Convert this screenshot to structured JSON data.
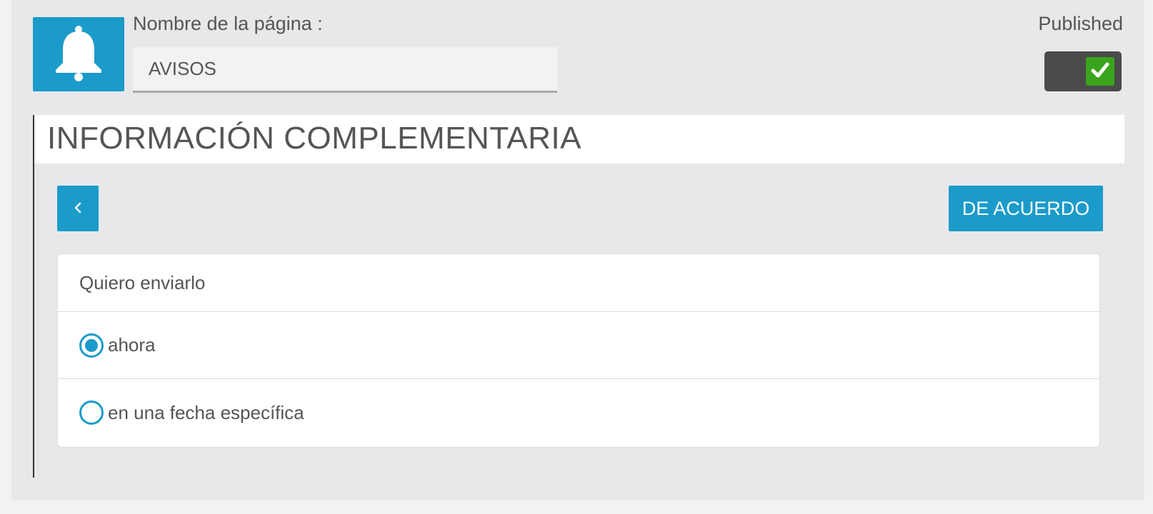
{
  "header": {
    "page_name_label": "Nombre de la página :",
    "page_name_value": "AVISOS",
    "page_icon": "bell-icon",
    "published_label": "Published",
    "published": true
  },
  "section": {
    "title": "INFORMACIÓN COMPLEMENTARIA",
    "back_icon": "chevron-left-icon",
    "ok_label": "DE ACUERDO"
  },
  "send_options": {
    "header": "Quiero enviarlo",
    "options": [
      {
        "label": "ahora",
        "selected": true
      },
      {
        "label": "en una fecha específica",
        "selected": false
      }
    ]
  },
  "colors": {
    "accent": "#1b9bca",
    "toggle_on": "#3aa51c",
    "toggle_bg": "#4a4a4a",
    "panel_bg": "#e8e8ea"
  }
}
